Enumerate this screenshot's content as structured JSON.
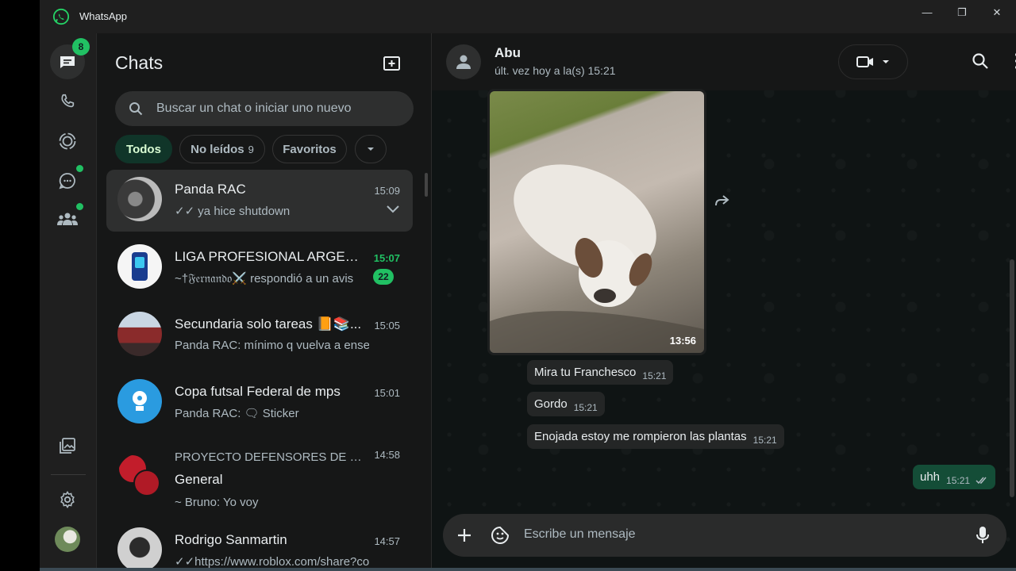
{
  "window": {
    "title": "WhatsApp"
  },
  "rail": {
    "chats_badge": "8"
  },
  "chat_list": {
    "title": "Chats",
    "search_placeholder": "Buscar un chat o iniciar uno nuevo",
    "filters": [
      {
        "label": "Todos"
      },
      {
        "label": "No leídos",
        "count": "9"
      },
      {
        "label": "Favoritos"
      }
    ],
    "chats": [
      {
        "name": "Panda RAC",
        "time": "15:09",
        "message": "✓✓ ya hice shutdown"
      },
      {
        "name": "LIGA PROFESIONAL ARGEN...",
        "time": "15:07",
        "message": "~†𝔉𝔢𝔯𝔫𝔞𝔫𝔡𝔬⚔️ respondió a un avis",
        "unread": "22"
      },
      {
        "name": "Secundaria solo tareas 📙📚...",
        "time": "15:05",
        "message": "Panda RAC: mínimo q vuelva a enseñar"
      },
      {
        "name": "Copa futsal Federal de mps",
        "time": "15:01",
        "message": "Panda RAC: 🗨 Sticker"
      },
      {
        "name": "PROYECTO DEFENSORES DE BEL...",
        "time": "14:58",
        "subname": "General",
        "message": "~ Bruno: Yo voy"
      },
      {
        "name": "Rodrigo Sanmartin",
        "time": "14:57",
        "message": "✓✓https://www.roblox.com/share?co"
      }
    ]
  },
  "conversation": {
    "contact_name": "Abu",
    "status": "últ. vez hoy a la(s) 15:21",
    "image_time": "13:56",
    "messages": [
      {
        "text": "Mira tu Franchesco",
        "time": "15:21",
        "direction": "in"
      },
      {
        "text": "Gordo",
        "time": "15:21",
        "direction": "in"
      },
      {
        "text": "Enojada estoy me rompieron las plantas",
        "time": "15:21",
        "direction": "in"
      },
      {
        "text": "uhh",
        "time": "15:21",
        "direction": "out"
      }
    ],
    "composer_placeholder": "Escribe un mensaje"
  },
  "colors": {
    "accent": "#21c063",
    "outgoing_bubble": "#144d37",
    "incoming_bubble": "#242626"
  }
}
